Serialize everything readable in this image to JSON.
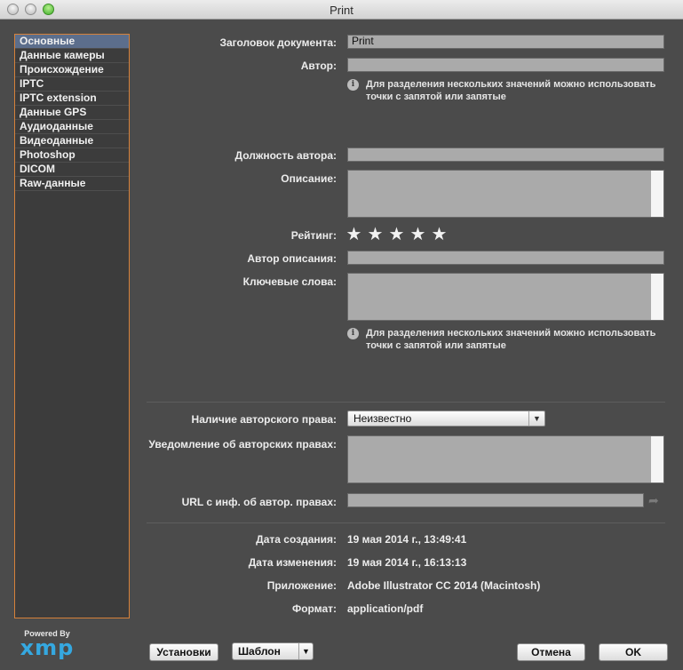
{
  "window": {
    "title": "Print"
  },
  "sidebar": {
    "items": [
      {
        "label": "Основные",
        "active": true
      },
      {
        "label": "Данные камеры"
      },
      {
        "label": "Происхождение"
      },
      {
        "label": "IPTC"
      },
      {
        "label": "IPTC extension"
      },
      {
        "label": "Данные GPS"
      },
      {
        "label": "Аудиоданные"
      },
      {
        "label": "Видеоданные"
      },
      {
        "label": "Photoshop"
      },
      {
        "label": "DICOM"
      },
      {
        "label": "Raw-данные"
      }
    ]
  },
  "branding": {
    "powered_by": "Powered By",
    "logo_text": "xmp"
  },
  "form": {
    "doc_title_label": "Заголовок документа:",
    "doc_title_value": "Print",
    "author_label": "Автор:",
    "author_value": "",
    "multi_value_hint": "Для разделения нескольких значений можно использовать точки с запятой или запятые",
    "author_title_label": "Должность автора:",
    "description_label": "Описание:",
    "rating_label": "Рейтинг:",
    "rating_value": 0,
    "description_writer_label": "Автор описания:",
    "keywords_label": "Ключевые слова:",
    "keywords_hint": "Для разделения нескольких значений можно использовать точки с запятой или запятые",
    "copyright_status_label": "Наличие авторского права:",
    "copyright_status_value": "Неизвестно",
    "copyright_notice_label": "Уведомление об авторских правах:",
    "copyright_url_label": "URL с инф. об автор. правах:",
    "created_label": "Дата создания:",
    "created_value": "19 мая 2014 г., 13:49:41",
    "modified_label": "Дата изменения:",
    "modified_value": "19 мая 2014 г., 16:13:13",
    "application_label": "Приложение:",
    "application_value": "Adobe Illustrator CC 2014 (Macintosh)",
    "format_label": "Формат:",
    "format_value": "application/pdf"
  },
  "buttons": {
    "setup": "Установки",
    "template": "Шаблон",
    "cancel": "Отмена",
    "ok": "OK"
  },
  "icons": {
    "info": "info-icon",
    "star": "star-icon",
    "dropdown": "chevron-down-icon",
    "go": "arrow-icon"
  },
  "colors": {
    "background": "#4b4b4b",
    "sidebar_border": "#d6813a",
    "sidebar_active": "#5c6e8c",
    "field": "#aaaaaa",
    "xmp_brand": "#35a8e0"
  }
}
